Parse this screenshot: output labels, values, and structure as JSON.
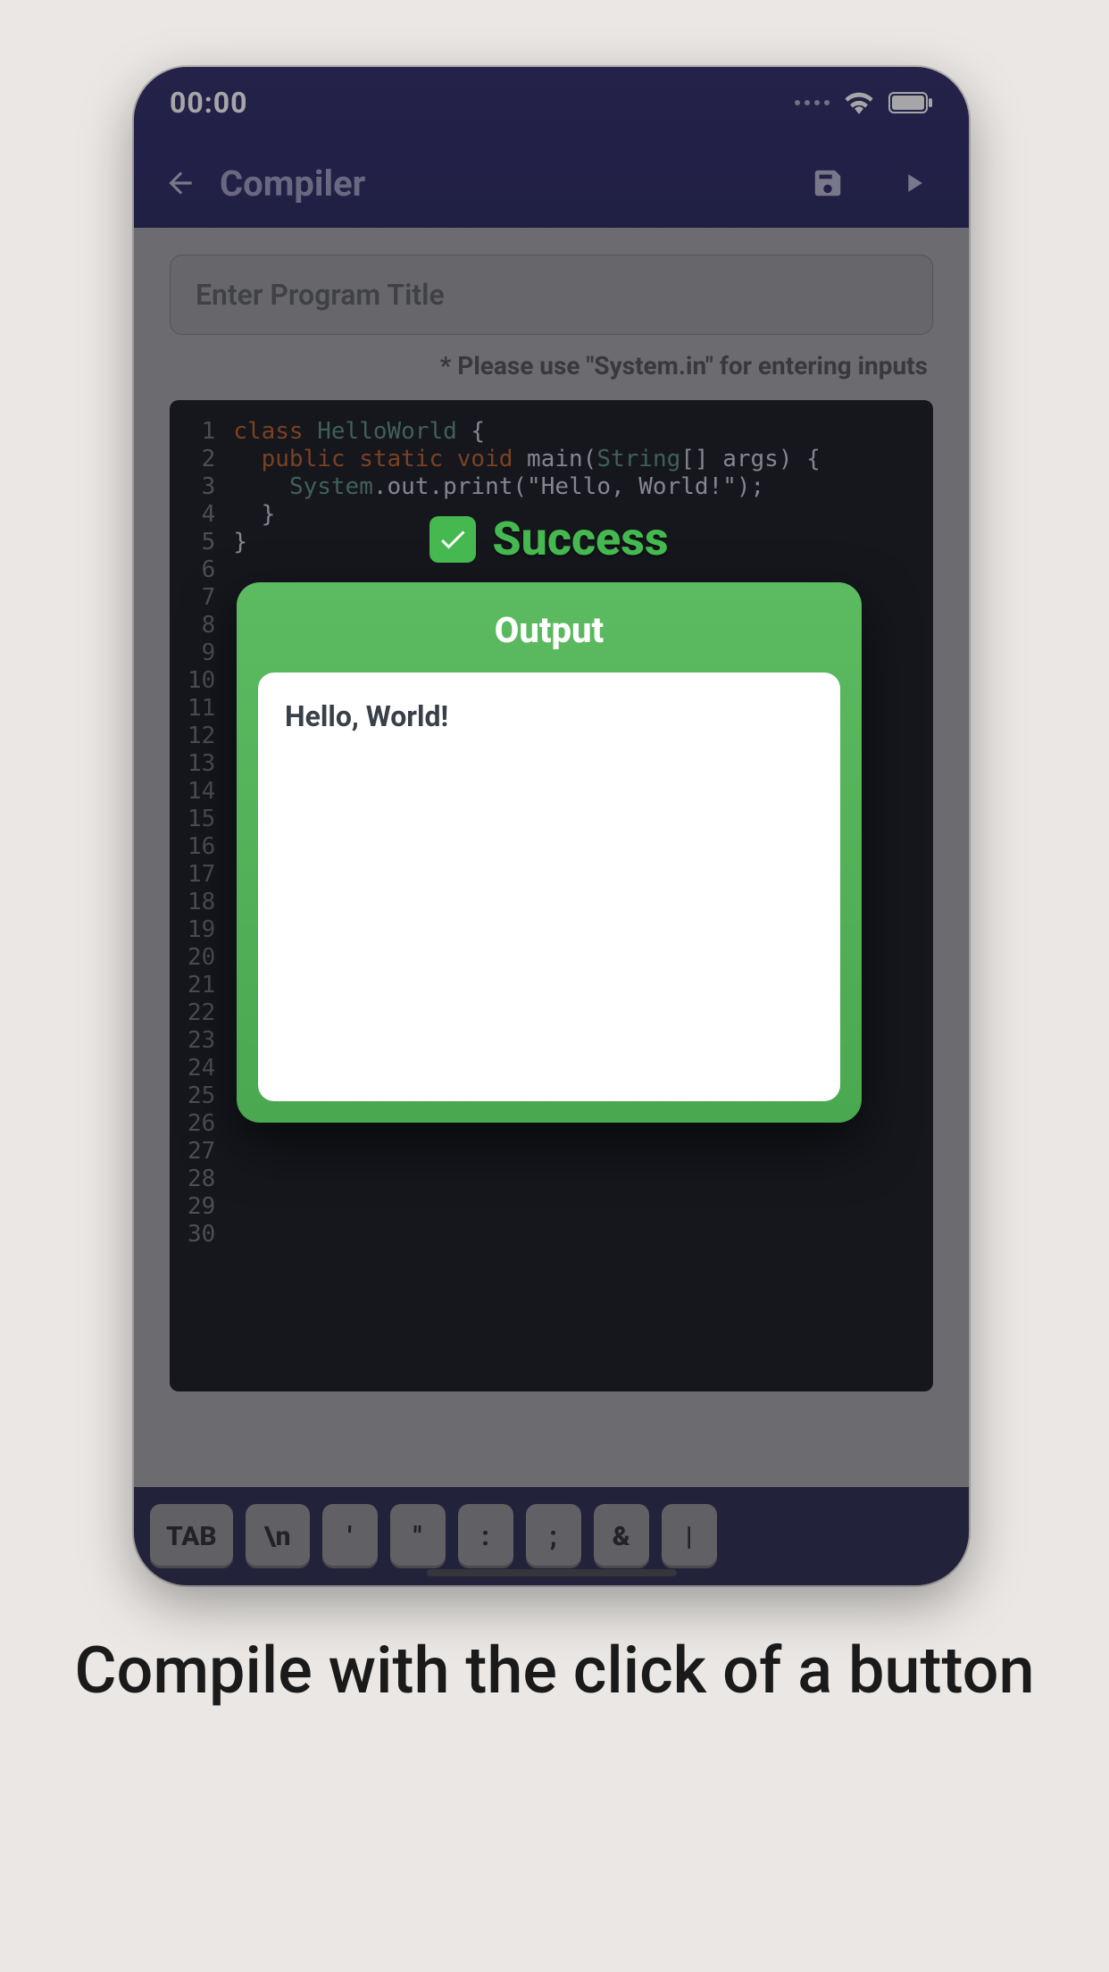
{
  "status": {
    "time": "00:00"
  },
  "appbar": {
    "title": "Compiler",
    "back_name": "back-icon",
    "save_name": "save-icon",
    "run_name": "play-icon"
  },
  "editor": {
    "title_placeholder": "Enter Program Title",
    "hint": "* Please use \"System.in\" for entering inputs",
    "line_count": 30,
    "code_tokens": [
      [
        {
          "t": "class ",
          "c": "kw"
        },
        {
          "t": "HelloWorld ",
          "c": "cls"
        },
        {
          "t": "{",
          "c": ""
        }
      ],
      [
        {
          "t": "  public static void ",
          "c": "kw"
        },
        {
          "t": "main",
          "c": ""
        },
        {
          "t": "(",
          "c": ""
        },
        {
          "t": "String",
          "c": "type"
        },
        {
          "t": "[] args) {",
          "c": ""
        }
      ],
      [
        {
          "t": "    ",
          "c": ""
        },
        {
          "t": "System",
          "c": "obj"
        },
        {
          "t": ".out.print(\"Hello, World!\");",
          "c": ""
        }
      ],
      [
        {
          "t": "  }",
          "c": ""
        }
      ],
      [
        {
          "t": "}",
          "c": ""
        }
      ]
    ]
  },
  "modal": {
    "success_label": "Success",
    "output_title": "Output",
    "output_text": "Hello, World!"
  },
  "kbar": {
    "keys": [
      "TAB",
      "\\n",
      "'",
      "\"",
      ":",
      ";",
      "&",
      "|"
    ]
  },
  "caption": "Compile with the click of a button"
}
